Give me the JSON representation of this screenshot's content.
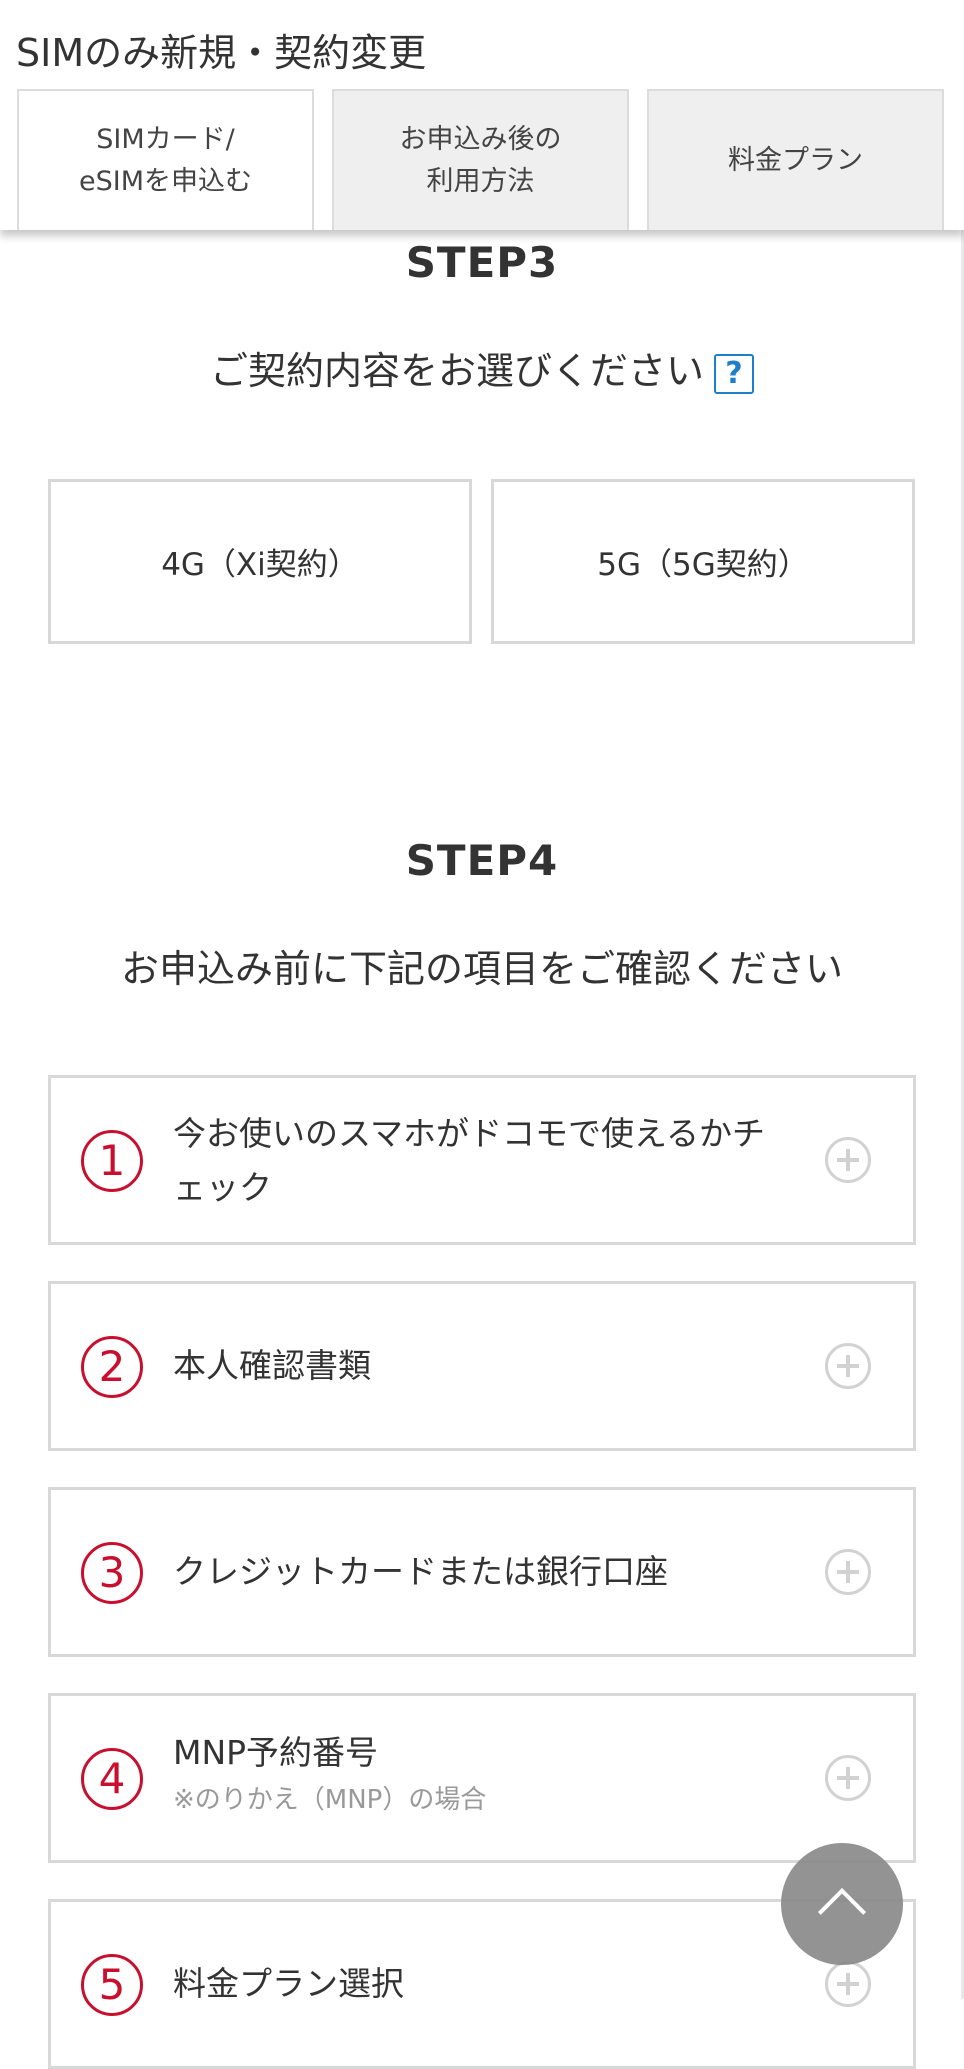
{
  "header": {
    "title": "SIMのみ新規・契約変更",
    "tabs": [
      {
        "line1": "SIMカード/",
        "line2": "eSIMを申込む",
        "active": true
      },
      {
        "line1": "お申込み後の",
        "line2": "利用方法",
        "active": false
      },
      {
        "line1": "料金プラン",
        "line2": "",
        "active": false
      }
    ]
  },
  "step3": {
    "heading": "STEP3",
    "subtitle": "ご契約内容をお選びください",
    "help_label": "?",
    "options": [
      {
        "label": "4G（Xi契約）"
      },
      {
        "label": "5G（5G契約）"
      }
    ]
  },
  "step4": {
    "heading": "STEP4",
    "subtitle": "お申込み前に下記の項目をご確認ください",
    "items": [
      {
        "number": "1",
        "line1": "今お使いのスマホがドコモで使えるかチ",
        "line2": "ェック",
        "note": ""
      },
      {
        "number": "2",
        "line1": "本人確認書類",
        "line2": "",
        "note": ""
      },
      {
        "number": "3",
        "line1": "クレジットカードまたは銀行口座",
        "line2": "",
        "note": ""
      },
      {
        "number": "4",
        "line1": "MNP予約番号",
        "line2": "",
        "note": "※のりかえ（MNP）の場合"
      },
      {
        "number": "5",
        "line1": "料金プラン選択",
        "line2": "",
        "note": ""
      }
    ]
  },
  "colors": {
    "accent_red": "#c8102e",
    "help_blue": "#1e7fc9",
    "border_gray": "#d8d8d8",
    "tab_bg": "#efefef"
  },
  "icons": {
    "help": "question-box-icon",
    "expand": "plus-circle-icon",
    "scroll_top": "chevron-up-icon"
  }
}
